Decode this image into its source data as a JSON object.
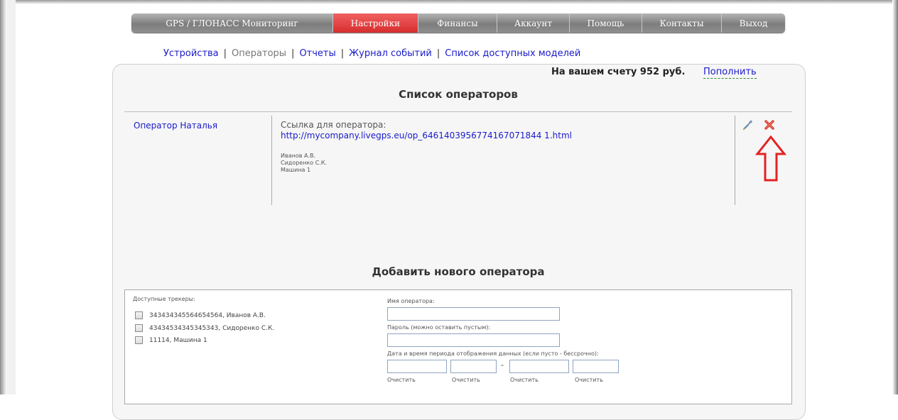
{
  "topnav": {
    "items": [
      {
        "label": "GPS / ГЛОНАСС Мониторинг"
      },
      {
        "label": "Настройки"
      },
      {
        "label": "Финансы"
      },
      {
        "label": "Аккаунт"
      },
      {
        "label": "Помощь"
      },
      {
        "label": "Контакты"
      },
      {
        "label": "Выход"
      }
    ],
    "active_color": "#e04040"
  },
  "subnav": {
    "items": [
      {
        "label": "Устройства"
      },
      {
        "label": "Операторы"
      },
      {
        "label": "Отчеты"
      },
      {
        "label": "Журнал событий"
      },
      {
        "label": "Список доступных моделей"
      }
    ],
    "separator": "|"
  },
  "balance": {
    "text": "На вашем счету 952 руб.",
    "topup_label": "Пополнить"
  },
  "operators_list": {
    "title": "Список операторов",
    "operators": [
      {
        "name": "Оператор Наталья",
        "link_label": "Ссылка для оператора:",
        "link_url": "http://mycompany.livegps.eu/op_6461403956774167071844 1.html",
        "assigned": [
          "Иванов А.В.",
          "Сидоренко С.К.",
          "Машина 1"
        ]
      }
    ],
    "icons": {
      "edit": "wrench-icon",
      "delete": "close-icon",
      "annotation": "arrow-up-icon"
    }
  },
  "add_operator": {
    "title": "Добавить нового оператора",
    "trackers_label": "Доступные трекеры:",
    "trackers": [
      "343434345564654564, Иванов А.В.",
      "43434534345345343, Сидоренко С.К.",
      "11114, Машина 1"
    ],
    "name_label": "Имя оператора:",
    "name_value": "",
    "password_label": "Пароль (можно оставить пустым):",
    "password_value": "",
    "period_label": "Дата и время периода отображения данных (если пусто - бессрочно):",
    "period_separator": "-",
    "clear_label": "Очистить"
  }
}
